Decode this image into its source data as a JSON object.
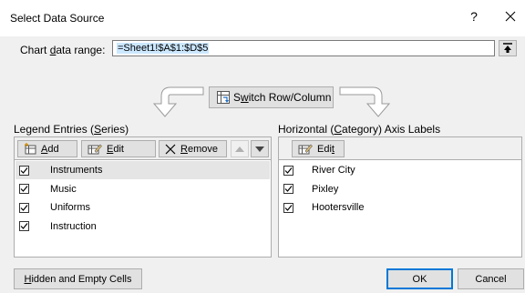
{
  "window": {
    "title": "Select Data Source",
    "help_glyph": "?"
  },
  "range": {
    "label_pre": "Chart ",
    "label_accel": "d",
    "label_post": "ata range:",
    "value": "=Sheet1!$A$1:$D$5"
  },
  "switch": {
    "label_pre": "S",
    "label_accel": "w",
    "label_post": "itch Row/Column"
  },
  "legend": {
    "title_pre": "Legend Entries (",
    "title_accel": "S",
    "title_post": "eries)",
    "add_pre": "",
    "add_accel": "A",
    "add_post": "dd",
    "edit_pre": "",
    "edit_accel": "E",
    "edit_post": "dit",
    "remove_pre": "",
    "remove_accel": "R",
    "remove_post": "emove",
    "items": [
      {
        "label": "Instruments",
        "checked": true,
        "selected": true
      },
      {
        "label": "Music",
        "checked": true,
        "selected": false
      },
      {
        "label": "Uniforms",
        "checked": true,
        "selected": false
      },
      {
        "label": "Instruction",
        "checked": true,
        "selected": false
      }
    ]
  },
  "axis": {
    "title_pre": "Horizontal (",
    "title_accel": "C",
    "title_post": "ategory) Axis Labels",
    "edit_pre": "Edi",
    "edit_accel": "t",
    "edit_post": "",
    "items": [
      {
        "label": "River City",
        "checked": true
      },
      {
        "label": "Pixley",
        "checked": true
      },
      {
        "label": "Hootersville",
        "checked": true
      }
    ]
  },
  "footer": {
    "hidden_pre": "",
    "hidden_accel": "H",
    "hidden_post": "idden and Empty Cells",
    "ok_label": "OK",
    "cancel_label": "Cancel"
  },
  "colors": {
    "accent": "#0078d7",
    "selection": "#cce8ff",
    "selected_row": "#e5e5e5"
  }
}
